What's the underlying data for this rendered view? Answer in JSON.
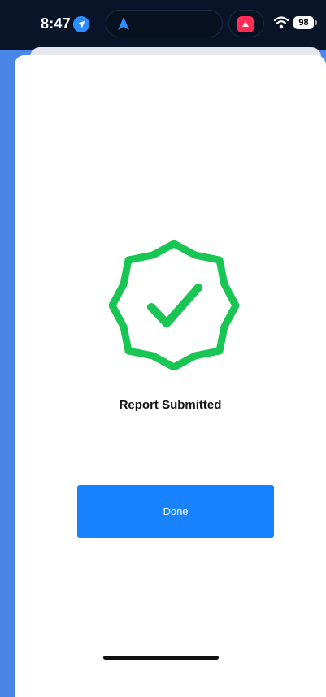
{
  "status_bar": {
    "time": "8:47",
    "battery": "98"
  },
  "main": {
    "title": "Report Submitted",
    "done_label": "Done"
  },
  "icons": {
    "location": "location-arrow-icon",
    "navigation": "navigation-arrow-icon",
    "app": "app-badge-icon",
    "wifi": "wifi-icon",
    "success": "check-badge-icon"
  },
  "colors": {
    "accent": "#1882ff",
    "success": "#19c654",
    "background": "#4a86e8"
  }
}
